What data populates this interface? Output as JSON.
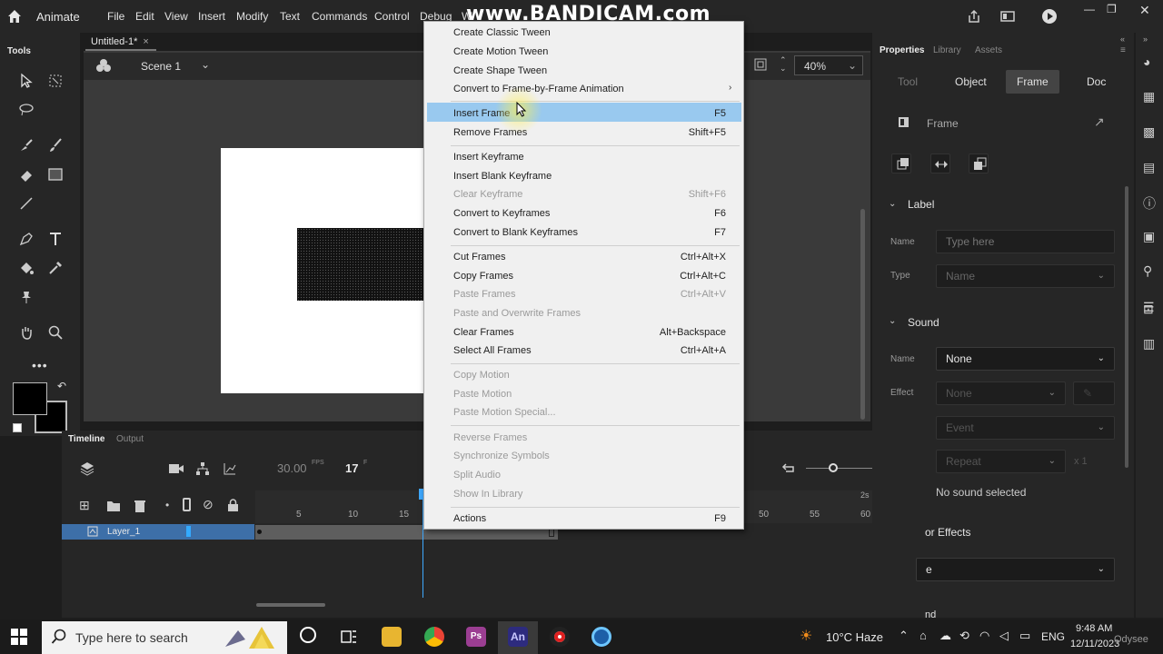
{
  "app": {
    "name": "Animate"
  },
  "watermark": "www.BANDICAM.com",
  "menu": [
    "File",
    "Edit",
    "View",
    "Insert",
    "Modify",
    "Text",
    "Commands",
    "Control",
    "Debug",
    "W"
  ],
  "tools_title": "Tools",
  "document": {
    "tab": "Untitled-1*",
    "close": "×",
    "scene": "Scene 1",
    "zoom": "40%"
  },
  "timeline": {
    "tab_active": "Timeline",
    "tab_inactive": "Output",
    "fps": "30.00",
    "fps_unit": "FPS",
    "frame": "17",
    "frame_unit": "F",
    "ruler": [
      "5",
      "10",
      "15",
      "50",
      "55",
      "60"
    ],
    "ruler_seconds": "2s",
    "layer": "Layer_1"
  },
  "properties": {
    "tabs": [
      "Properties",
      "Library",
      "Assets"
    ],
    "subtabs": [
      "Tool",
      "Object",
      "Frame",
      "Doc"
    ],
    "active_subtab": "Frame",
    "header": "Frame",
    "label_section": "Label",
    "name_label": "Name",
    "name_placeholder": "Type here",
    "type_label": "Type",
    "type_value": "Name",
    "sound_section": "Sound",
    "sound_name_label": "Name",
    "sound_name_value": "None",
    "effect_label": "Effect",
    "effect_value": "None",
    "event_value": "Event",
    "repeat_value": "Repeat",
    "repeat_count": "x 1",
    "no_sound": "No sound selected",
    "color_effects": "or Effects",
    "partial_field": "e",
    "bottom_partial": "nd"
  },
  "context_menu": {
    "items": [
      {
        "label": "Create Classic Tween",
        "shortcut": "",
        "disabled": false
      },
      {
        "label": "Create Motion Tween",
        "shortcut": "",
        "disabled": false
      },
      {
        "label": "Create Shape Tween",
        "shortcut": "",
        "disabled": false
      },
      {
        "label": "Convert to Frame-by-Frame Animation",
        "shortcut": "",
        "disabled": false,
        "submenu": true
      },
      {
        "label": "Insert Frame",
        "shortcut": "F5",
        "disabled": false,
        "highlighted": true
      },
      {
        "label": "Remove Frames",
        "shortcut": "Shift+F5",
        "disabled": false
      },
      {
        "label": "Insert Keyframe",
        "shortcut": "",
        "disabled": false
      },
      {
        "label": "Insert Blank Keyframe",
        "shortcut": "",
        "disabled": false
      },
      {
        "label": "Clear Keyframe",
        "shortcut": "Shift+F6",
        "disabled": true
      },
      {
        "label": "Convert to Keyframes",
        "shortcut": "F6",
        "disabled": false
      },
      {
        "label": "Convert to Blank Keyframes",
        "shortcut": "F7",
        "disabled": false
      },
      {
        "label": "Cut Frames",
        "shortcut": "Ctrl+Alt+X",
        "disabled": false
      },
      {
        "label": "Copy Frames",
        "shortcut": "Ctrl+Alt+C",
        "disabled": false
      },
      {
        "label": "Paste Frames",
        "shortcut": "Ctrl+Alt+V",
        "disabled": true
      },
      {
        "label": "Paste and Overwrite Frames",
        "shortcut": "",
        "disabled": true
      },
      {
        "label": "Clear Frames",
        "shortcut": "Alt+Backspace",
        "disabled": false
      },
      {
        "label": "Select All Frames",
        "shortcut": "Ctrl+Alt+A",
        "disabled": false
      },
      {
        "label": "Copy Motion",
        "shortcut": "",
        "disabled": true
      },
      {
        "label": "Paste Motion",
        "shortcut": "",
        "disabled": true
      },
      {
        "label": "Paste Motion Special...",
        "shortcut": "",
        "disabled": true
      },
      {
        "label": "Reverse Frames",
        "shortcut": "",
        "disabled": true
      },
      {
        "label": "Synchronize Symbols",
        "shortcut": "",
        "disabled": true
      },
      {
        "label": "Split Audio",
        "shortcut": "",
        "disabled": true
      },
      {
        "label": "Show In Library",
        "shortcut": "",
        "disabled": true
      },
      {
        "label": "Actions",
        "shortcut": "F9",
        "disabled": false
      }
    ],
    "submenu_arrow": "›"
  },
  "taskbar": {
    "search_placeholder": "Type here to search",
    "weather": "10°C Haze",
    "language": "ENG",
    "time": "9:48 AM",
    "date": "12/11/2023",
    "partial": "Odysee"
  },
  "colors": {
    "highlight": "#99c9ef",
    "layer_selected": "#3d6fa8",
    "playhead": "#3fa9ff",
    "animate_icon": "#2d2b7e"
  }
}
